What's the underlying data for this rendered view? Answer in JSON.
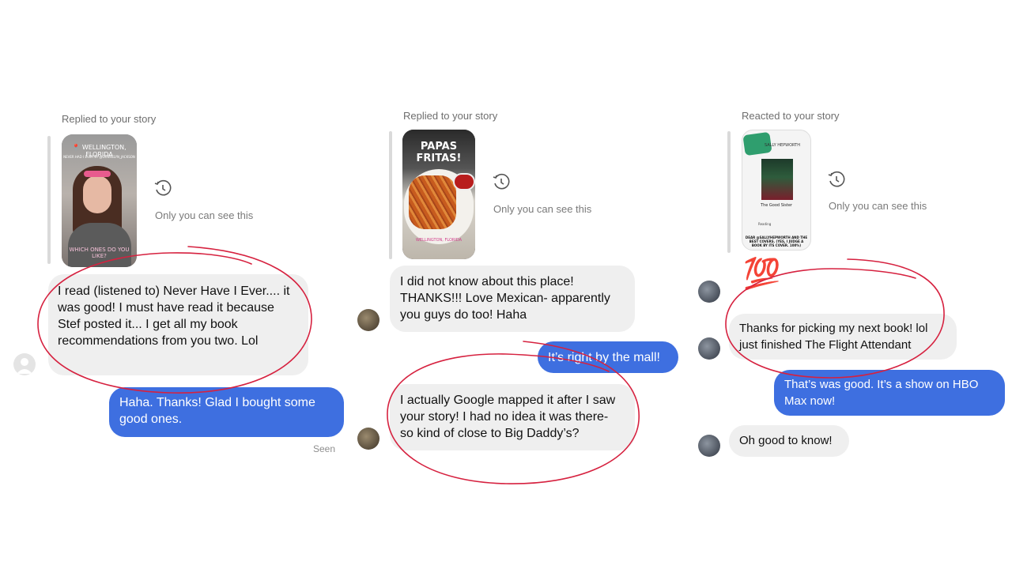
{
  "panels": [
    {
      "header": "Replied to your story",
      "story": {
        "location": "WELLINGTON, FLORIDA",
        "subtitle": "NEVER HAD I EVER BY @GOSHELYN_JACKSON",
        "caption": "WHICH ONES DO YOU LIKE?"
      },
      "private_note": "Only you can see this",
      "messages": [
        {
          "from": "them",
          "text": "I read (listened to) Never Have I Ever.... it was good! I must have read it because Stef posted it... I get all my book recommendations from you two. Lol"
        },
        {
          "from": "me",
          "text": "Haha. Thanks! Glad I bought some good ones."
        }
      ],
      "status": "Seen"
    },
    {
      "header": "Replied to your story",
      "story": {
        "title": "PAPAS FRITAS!",
        "tag": "WELLINGTON, FLORIDA"
      },
      "private_note": "Only you can see this",
      "messages": [
        {
          "from": "them",
          "text": "I did not know about this place! THANKS!!! Love Mexican- apparently you guys do too! Haha"
        },
        {
          "from": "me",
          "text": "It’s right by the mall!"
        },
        {
          "from": "them",
          "text": "I actually Google mapped it after I saw your story! I had no idea it was there- so kind of close to Big Daddy’s?"
        }
      ]
    },
    {
      "header": "Reacted to your story",
      "story": {
        "author": "SALLY HEPWORTH",
        "book_title": "The Good Sister",
        "reading": "Reading",
        "caption": "DEAR @SALLYHEPWORTH AND THE BEST COVERS. (YES, I JUDGE A BOOK BY ITS COVER. 100%)"
      },
      "private_note": "Only you can see this",
      "reaction": "💯",
      "messages": [
        {
          "from": "them",
          "text": "Thanks for picking my next book! lol just finished The Flight Attendant"
        },
        {
          "from": "me",
          "text": "That’s was good. It’s a show on HBO Max now!"
        },
        {
          "from": "them",
          "text": "Oh good to know!"
        }
      ]
    }
  ],
  "colors": {
    "outgoing": "#3e6fe0",
    "incoming": "#efefef",
    "annotation": "#d6213f"
  }
}
